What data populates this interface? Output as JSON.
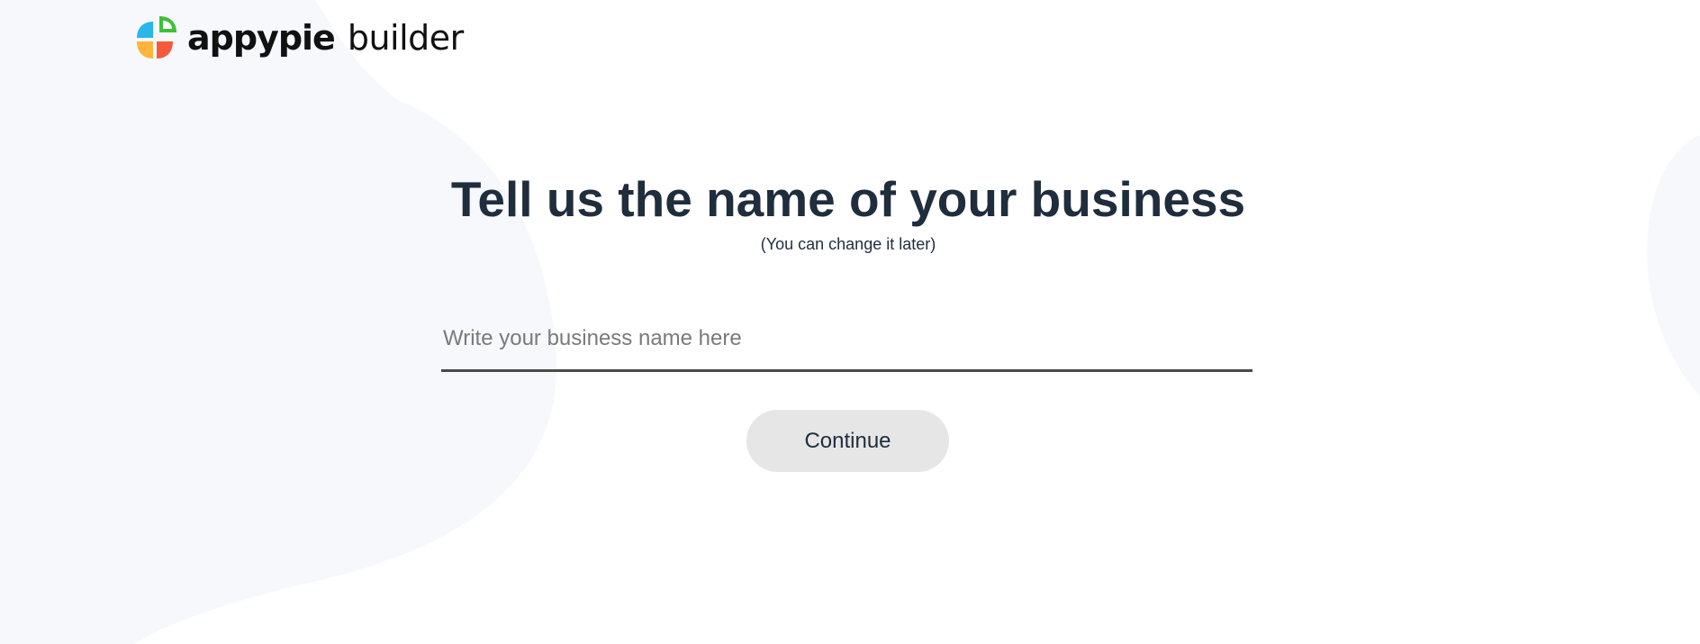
{
  "header": {
    "brand_name": "appypie",
    "product_name": "builder"
  },
  "main": {
    "title": "Tell us the name of your business",
    "subtitle": "(You can change it later)",
    "business_input": {
      "value": "",
      "placeholder": "Write your business name here"
    },
    "continue_label": "Continue"
  },
  "colors": {
    "background": "#ffffff",
    "blob": "#f6f8fc",
    "text": "#1f2d3d",
    "button_bg": "#e6e6e6",
    "input_underline": "#4a4a4a"
  }
}
